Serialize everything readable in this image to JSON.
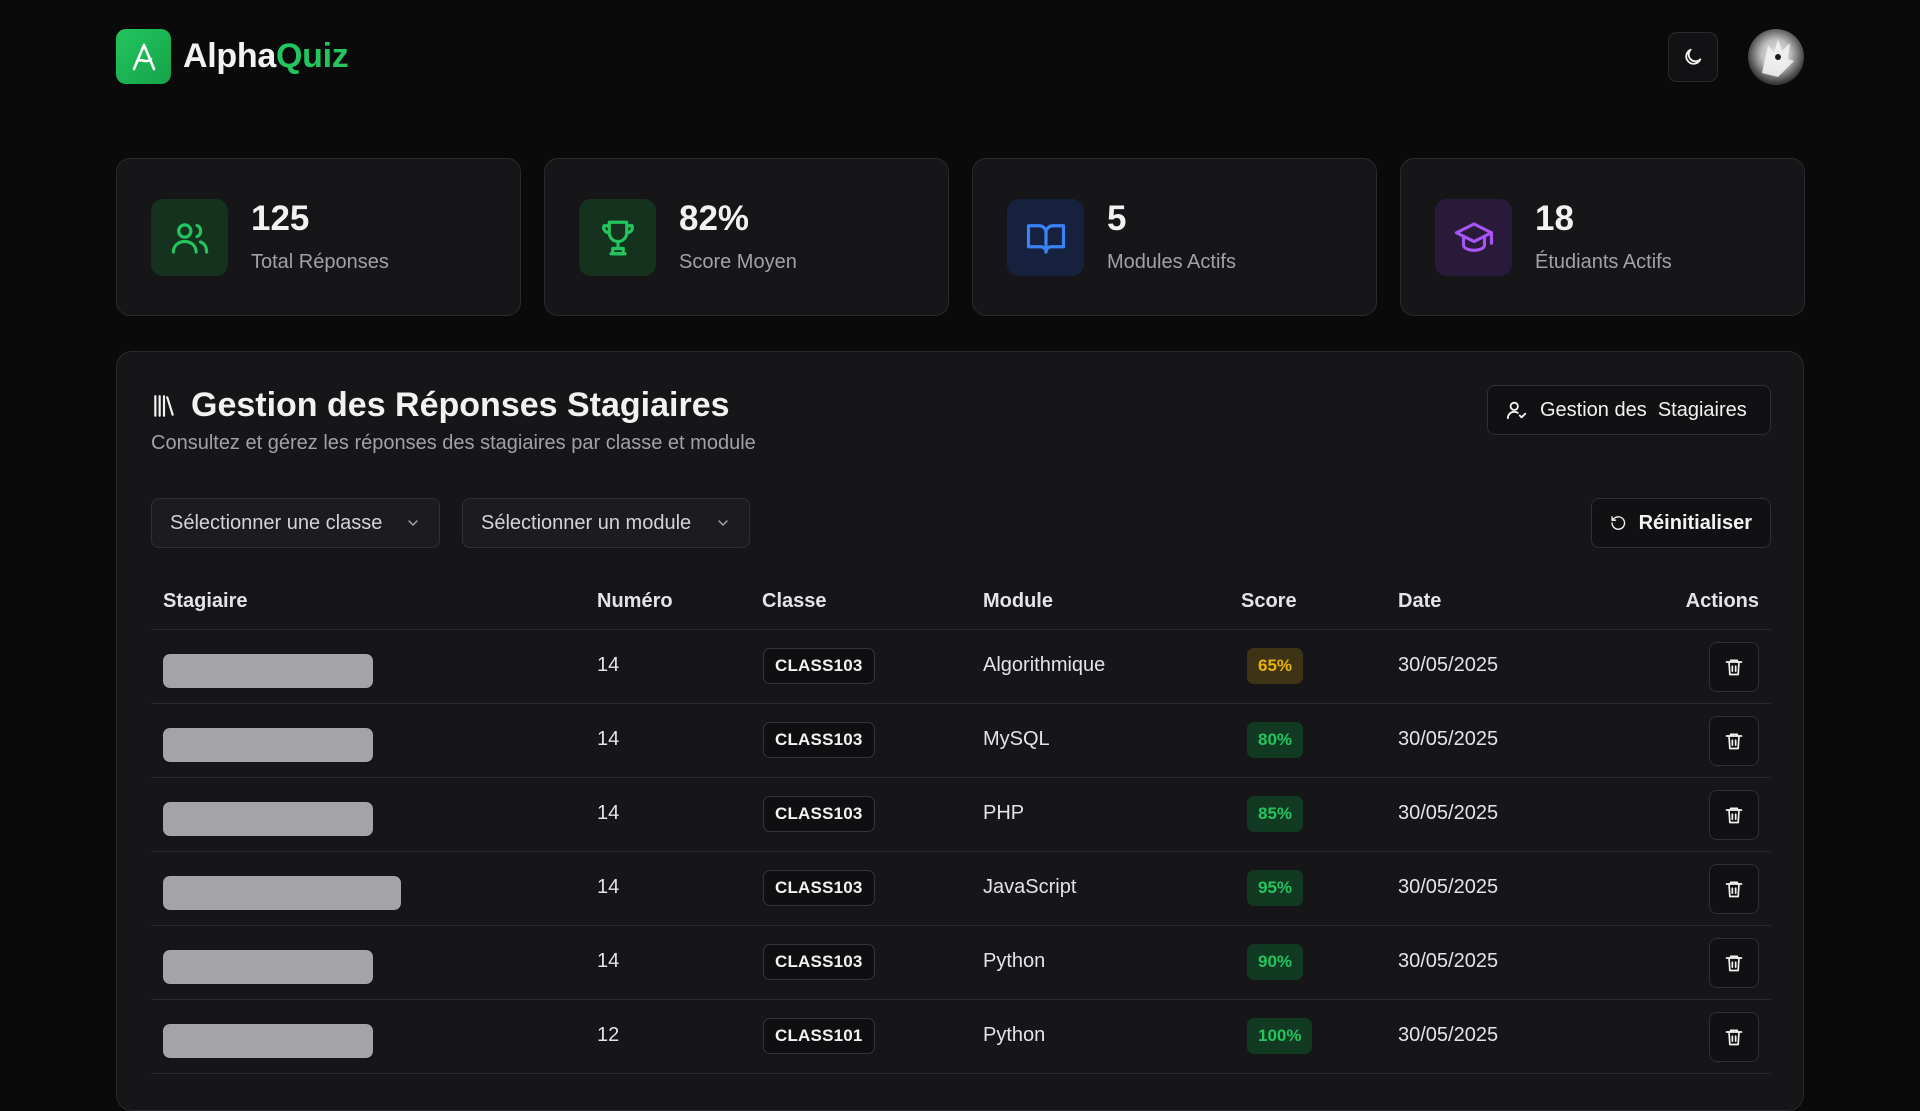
{
  "app": {
    "brand_primary": "Alpha",
    "brand_accent": "Quiz",
    "accent_color": "#22c55e"
  },
  "stats": [
    {
      "value": "125",
      "label": "Total Réponses",
      "icon": "users-icon",
      "color": "#22c55e"
    },
    {
      "value": "82%",
      "label": "Score Moyen",
      "icon": "trophy-icon",
      "color": "#22c55e"
    },
    {
      "value": "5",
      "label": "Modules Actifs",
      "icon": "book-open-icon",
      "color": "#3b82f6"
    },
    {
      "value": "18",
      "label": "Étudiants Actifs",
      "icon": "graduation-cap-icon",
      "color": "#a855f7"
    }
  ],
  "panel": {
    "title": "Gestion des Réponses Stagiaires",
    "subtitle": "Consultez et gérez les réponses des stagiaires par classe et module",
    "manage_button": "Gestion des  Stagiaires",
    "reset_button": "Réinitialiser",
    "class_select": "Sélectionner une classe",
    "module_select": "Sélectionner un module"
  },
  "table": {
    "headers": [
      "Stagiaire",
      "Numéro",
      "Classe",
      "Module",
      "Score",
      "Date",
      "Actions"
    ],
    "rows": [
      {
        "numero": "14",
        "classe": "CLASS103",
        "module": "Algorithmique",
        "score": "65%",
        "score_level": "mid",
        "date": "30/05/2025"
      },
      {
        "numero": "14",
        "classe": "CLASS103",
        "module": "MySQL",
        "score": "80%",
        "score_level": "high",
        "date": "30/05/2025"
      },
      {
        "numero": "14",
        "classe": "CLASS103",
        "module": "PHP",
        "score": "85%",
        "score_level": "high",
        "date": "30/05/2025"
      },
      {
        "numero": "14",
        "classe": "CLASS103",
        "module": "JavaScript",
        "score": "95%",
        "score_level": "high",
        "date": "30/05/2025"
      },
      {
        "numero": "14",
        "classe": "CLASS103",
        "module": "Python",
        "score": "90%",
        "score_level": "high",
        "date": "30/05/2025"
      },
      {
        "numero": "12",
        "classe": "CLASS101",
        "module": "Python",
        "score": "100%",
        "score_level": "high",
        "date": "30/05/2025"
      }
    ]
  }
}
